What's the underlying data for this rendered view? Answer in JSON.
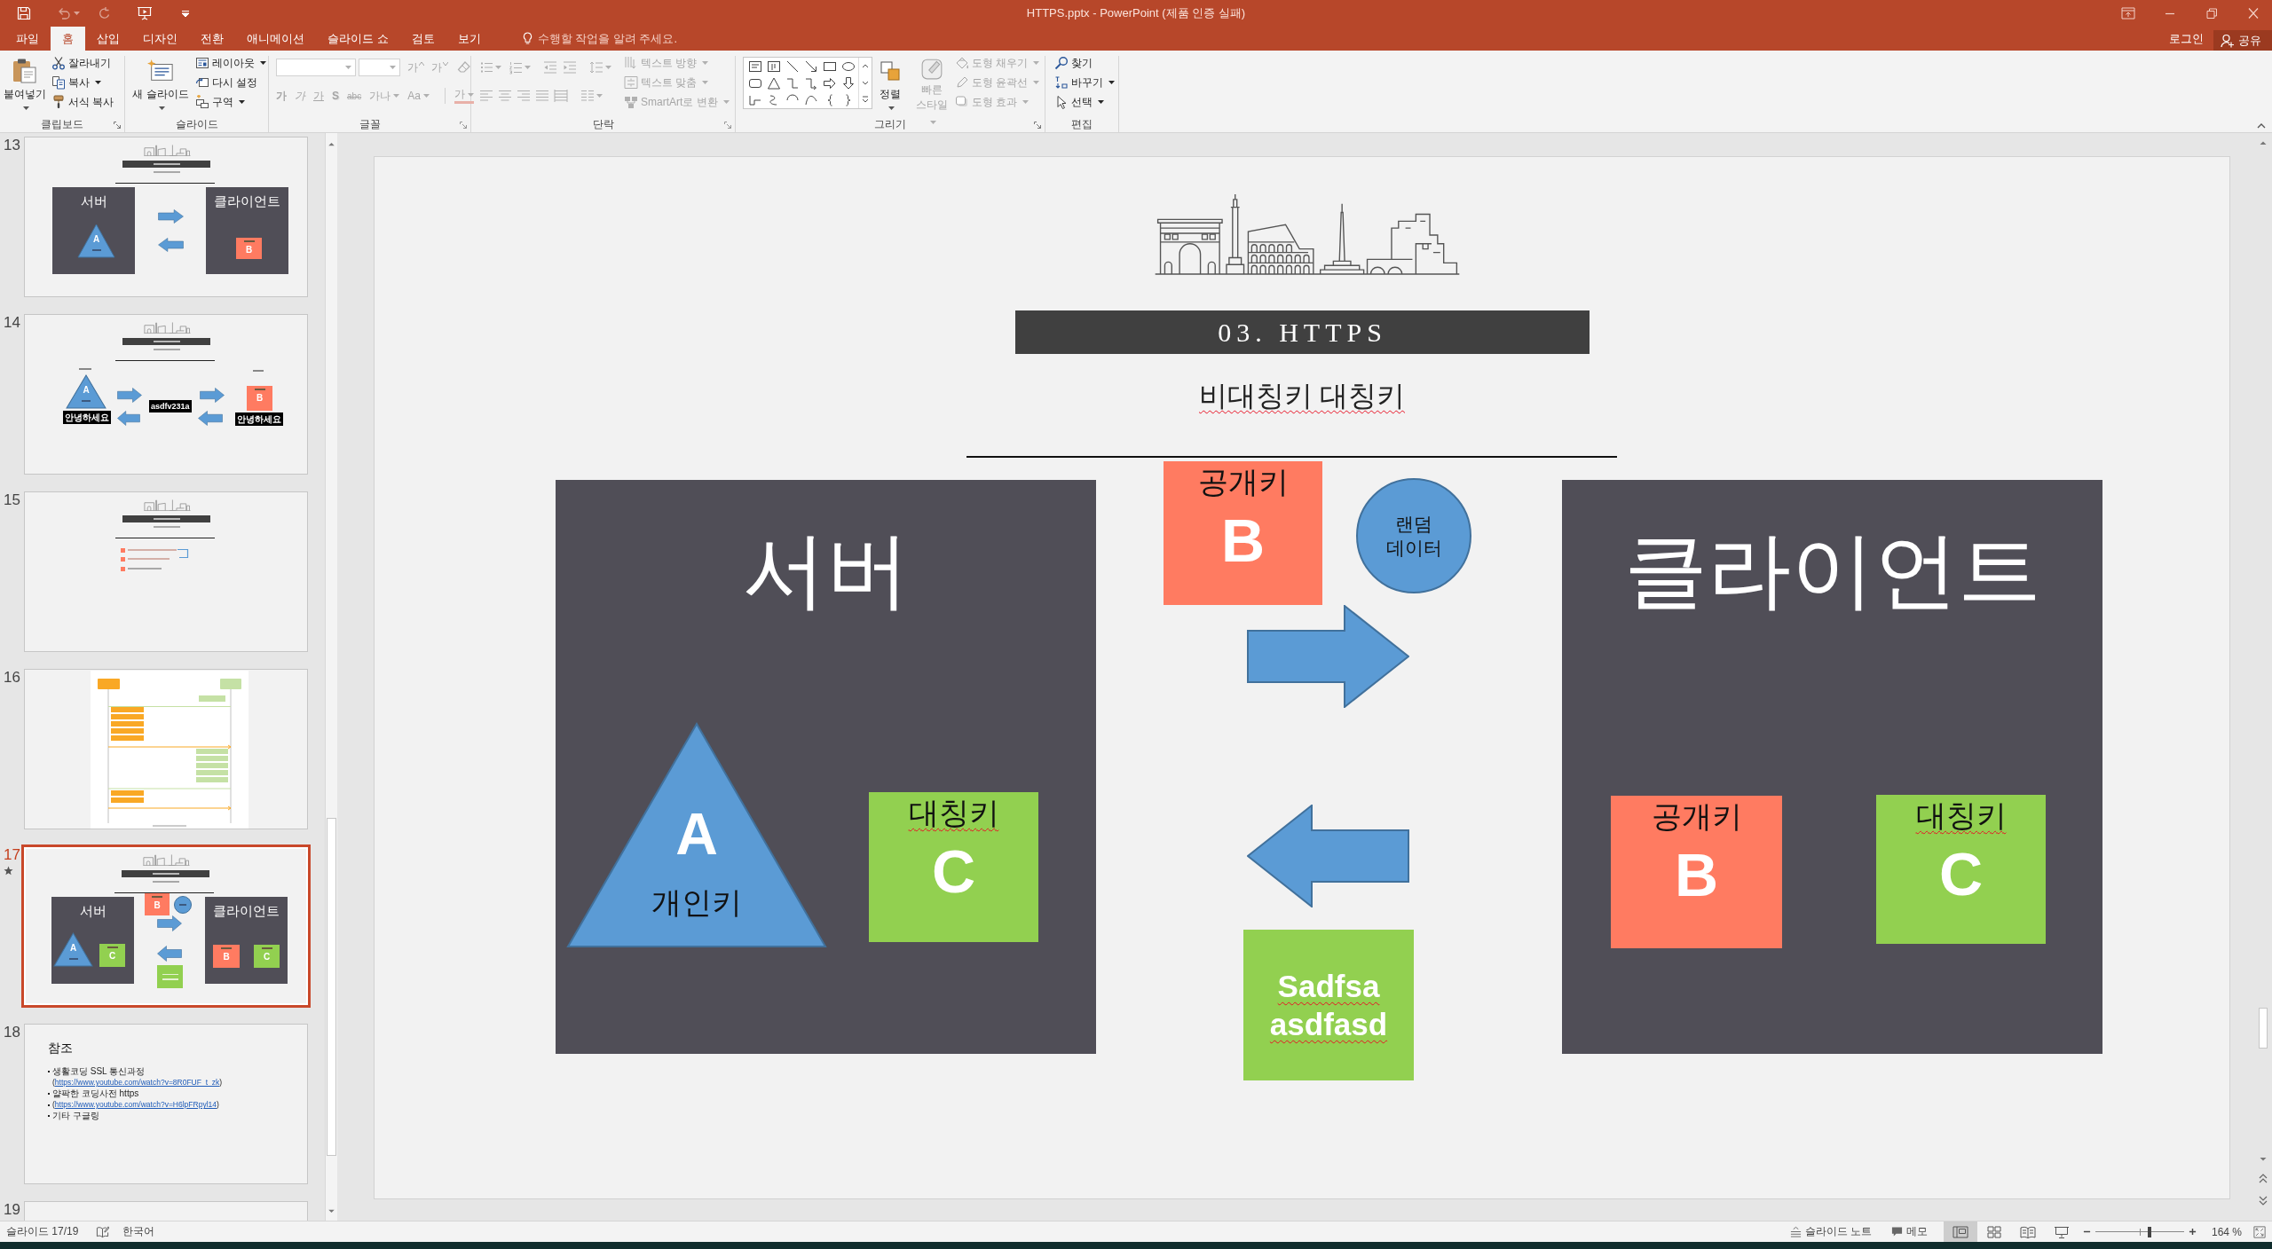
{
  "window": {
    "title": "HTTPS.pptx - PowerPoint (제품 인증 실패)"
  },
  "quick_access": [
    {
      "kind": "save",
      "disabled": false
    },
    {
      "kind": "undo",
      "disabled": true
    },
    {
      "kind": "repeat",
      "disabled": true
    },
    {
      "kind": "slideshow",
      "disabled": false
    }
  ],
  "ribbon_tabs": [
    {
      "label": "파일",
      "selected": false
    },
    {
      "label": "홈",
      "selected": true
    },
    {
      "label": "삽입",
      "selected": false
    },
    {
      "label": "디자인",
      "selected": false
    },
    {
      "label": "전환",
      "selected": false
    },
    {
      "label": "애니메이션",
      "selected": false
    },
    {
      "label": "슬라이드 쇼",
      "selected": false
    },
    {
      "label": "검토",
      "selected": false
    },
    {
      "label": "보기",
      "selected": false
    }
  ],
  "tell_me": {
    "placeholder": "수행할 작업을 알려 주세요."
  },
  "account": {
    "sign_in": "로그인",
    "share": "공유"
  },
  "ribbon": {
    "clipboard": {
      "label": "클립보드",
      "disabled": false,
      "paste": "붙여넣기",
      "cut": "잘라내기",
      "copy": "복사",
      "format_painter": "서식 복사"
    },
    "slides": {
      "label": "슬라이드",
      "disabled": false,
      "new_slide": "새 슬라이드",
      "layout": "레이아웃",
      "reset": "다시 설정",
      "section": "구역"
    },
    "font": {
      "label": "글꼴",
      "disabled": true,
      "size_buttons": [
        "가",
        "가"
      ],
      "format_buttons": [
        "가",
        "가",
        "가",
        "S",
        "abc",
        "가나",
        "Aa",
        "가"
      ]
    },
    "paragraph": {
      "label": "단락",
      "disabled": true,
      "text_direction": "텍스트 방향",
      "align_text": "텍스트 맞춤",
      "smartart": "SmartArt로 변환"
    },
    "drawing": {
      "label": "그리기",
      "arrange": {
        "label": "정렬",
        "disabled": false
      },
      "quick_styles": {
        "label": "빠른 스타일",
        "disabled": true
      },
      "shape_fill": {
        "label": "도형 채우기",
        "disabled": true
      },
      "shape_outline": {
        "label": "도형 윤곽선",
        "disabled": true
      },
      "shape_effects": {
        "label": "도형 효과",
        "disabled": true
      }
    },
    "editing": {
      "label": "편집",
      "disabled": false,
      "find": "찾기",
      "replace": "바꾸기",
      "select": "선택"
    }
  },
  "slide_panel": {
    "slides": [
      {
        "number": "13",
        "kind": "key_exchange",
        "selected": false,
        "animated": false,
        "server": "서버",
        "client": "클라이언트",
        "private_letter": "A",
        "public_letter": "B"
      },
      {
        "number": "14",
        "kind": "encryption",
        "selected": false,
        "animated": false,
        "private_letter": "A",
        "public_letter": "B",
        "plain_left": "안녕하세요",
        "cipher": "asdfv231a",
        "plain_right": "안녕하세요"
      },
      {
        "number": "15",
        "kind": "list",
        "selected": false,
        "animated": false
      },
      {
        "number": "16",
        "kind": "diagram",
        "selected": false,
        "animated": false
      },
      {
        "number": "17",
        "kind": "key_exchange_full",
        "selected": true,
        "animated": true,
        "server": "서버",
        "client": "클라이언트",
        "private_letter": "A",
        "server_symmetric_letter": "C",
        "public_letter": "B",
        "client_public_letter": "B",
        "client_symmetric_letter": "C"
      },
      {
        "number": "18",
        "kind": "references",
        "selected": false,
        "animated": false,
        "title": "참조",
        "lines": [
          {
            "kind": "text",
            "bullet": true,
            "text": "생활코딩 SSL 통신과정"
          },
          {
            "kind": "link",
            "bullet": false,
            "before": "(",
            "link": "https://www.youtube.com/watch?v=8R0FUF_t_zk",
            "after": ")"
          },
          {
            "kind": "text",
            "bullet": true,
            "text": "얄팍한 코딩사전 https"
          },
          {
            "kind": "link",
            "bullet": true,
            "before": "(",
            "link": "https://www.youtube.com/watch?v=H6lpFRpyl14",
            "after": ")"
          },
          {
            "kind": "text",
            "bullet": true,
            "text": "기타 구글링"
          }
        ]
      },
      {
        "number": "19",
        "kind": "blank",
        "selected": false,
        "animated": false
      }
    ]
  },
  "slide": {
    "title": "03. HTTPS",
    "subtitle": {
      "text": "비대칭키 대칭키",
      "misspelled": true
    },
    "server": {
      "title": "서버",
      "private_key": {
        "letter": "A",
        "label": {
          "text": "개인키",
          "misspelled": false
        }
      },
      "symmetric_key": {
        "label": {
          "text": "대칭키",
          "misspelled": true
        },
        "letter": "C"
      }
    },
    "public_key": {
      "label": {
        "text": "공개키",
        "misspelled": false
      },
      "letter": "B"
    },
    "random_data": "랜덤 데이터",
    "ciphertext": {
      "text": "Sadfsa asdfasd",
      "misspelled": true
    },
    "client": {
      "title": "클라이언트",
      "public_key": {
        "label": {
          "text": "공개키",
          "misspelled": false
        },
        "letter": "B"
      },
      "symmetric_key": {
        "label": {
          "text": "대칭키",
          "misspelled": true
        },
        "letter": "C"
      }
    }
  },
  "status_bar": {
    "slide_indicator": "슬라이드 17/19",
    "language": "한국어",
    "notes": "슬라이드 노트",
    "comments": "메모",
    "views": [
      {
        "kind": "normal",
        "selected": true
      },
      {
        "kind": "sorter",
        "selected": false
      },
      {
        "kind": "reading",
        "selected": false
      },
      {
        "kind": "slideshow",
        "selected": false
      }
    ],
    "zoom": {
      "level": 0.61,
      "value": "164 %"
    }
  }
}
